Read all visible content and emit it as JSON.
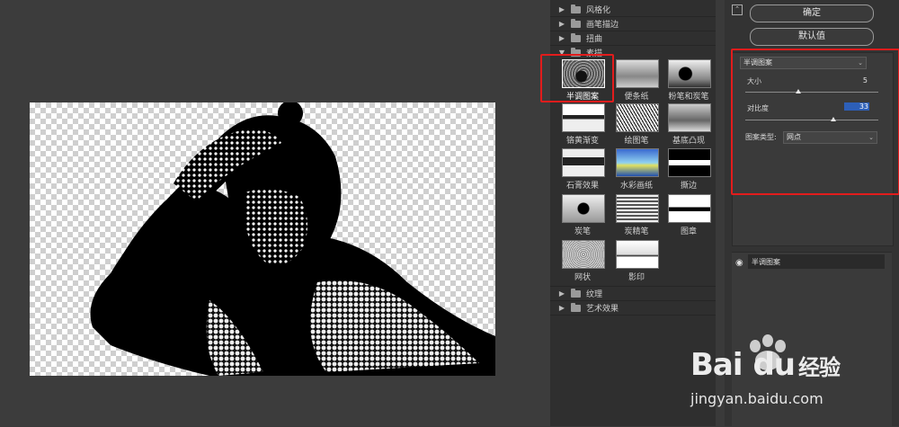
{
  "gallery": {
    "categories_top": [
      {
        "label": "风格化",
        "expanded": false
      },
      {
        "label": "画笔描边",
        "expanded": false
      },
      {
        "label": "扭曲",
        "expanded": false
      },
      {
        "label": "素描",
        "expanded": true
      }
    ],
    "thumbnails": [
      {
        "label": "半调图案",
        "selected": true
      },
      {
        "label": "便条纸"
      },
      {
        "label": "粉笔和炭笔"
      },
      {
        "label": "铬黄渐变"
      },
      {
        "label": "绘图笔"
      },
      {
        "label": "基底凸现"
      },
      {
        "label": "石膏效果"
      },
      {
        "label": "水彩画纸"
      },
      {
        "label": "撕边"
      },
      {
        "label": "炭笔"
      },
      {
        "label": "炭精笔"
      },
      {
        "label": "图章"
      },
      {
        "label": "网状"
      },
      {
        "label": "影印"
      }
    ],
    "categories_bottom": [
      {
        "label": "纹理",
        "expanded": false
      },
      {
        "label": "艺术效果",
        "expanded": false
      }
    ]
  },
  "right": {
    "collapse_icon": "collapse-up-icon",
    "ok_label": "确定",
    "default_label": "默认值",
    "filter_select": "半调图案",
    "size_label": "大小",
    "size_value": "5",
    "size_fraction": 0.4,
    "contrast_label": "对比度",
    "contrast_value": "33",
    "contrast_fraction": 0.66,
    "pattern_type_label": "图案类型:",
    "pattern_type_value": "网点",
    "layer_name": "半调图案"
  },
  "watermark": {
    "logo_text": "Bai",
    "logo_du": "du",
    "logo_cn": "经验",
    "url": "jingyan.baidu.com"
  },
  "colors": {
    "highlight_red": "#e21c1c",
    "panel_bg": "#3a3a3a",
    "gallery_bg": "#2f2f2f"
  }
}
